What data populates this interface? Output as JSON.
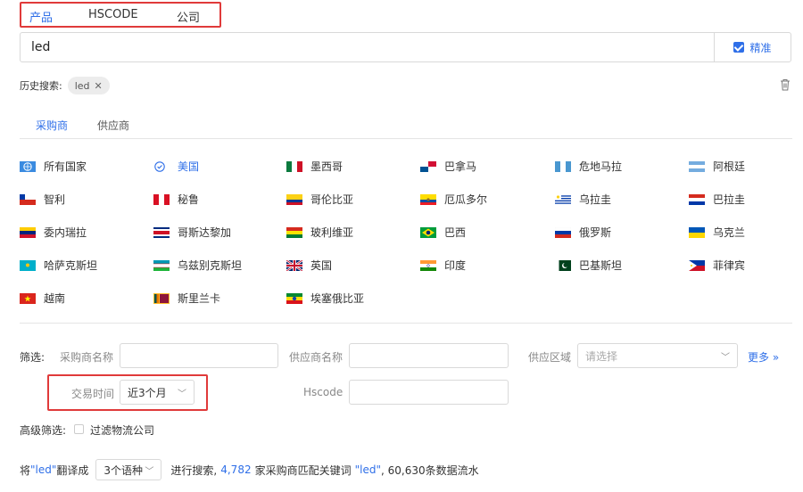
{
  "search_type_tabs": [
    {
      "label": "产品",
      "active": true
    },
    {
      "label": "HSCODE",
      "active": false
    },
    {
      "label": "公司",
      "active": false
    }
  ],
  "search": {
    "value": "led",
    "exact_label": "精准",
    "exact_checked": true
  },
  "history": {
    "label": "历史搜索:",
    "chips": [
      "led"
    ]
  },
  "role_tabs": [
    {
      "label": "采购商",
      "active": true
    },
    {
      "label": "供应商",
      "active": false
    }
  ],
  "countries": [
    {
      "name": "所有国家",
      "flag": "globe-icon"
    },
    {
      "name": "美国",
      "flag": "check-circle-icon",
      "selected": true
    },
    {
      "name": "墨西哥",
      "flag": "mexico-flag"
    },
    {
      "name": "巴拿马",
      "flag": "panama-flag"
    },
    {
      "name": "危地马拉",
      "flag": "guatemala-flag"
    },
    {
      "name": "阿根廷",
      "flag": "argentina-flag"
    },
    {
      "name": "智利",
      "flag": "chile-flag"
    },
    {
      "name": "秘鲁",
      "flag": "peru-flag"
    },
    {
      "name": "哥伦比亚",
      "flag": "colombia-flag"
    },
    {
      "name": "厄瓜多尔",
      "flag": "ecuador-flag"
    },
    {
      "name": "乌拉圭",
      "flag": "uruguay-flag"
    },
    {
      "name": "巴拉圭",
      "flag": "paraguay-flag"
    },
    {
      "name": "委内瑞拉",
      "flag": "venezuela-flag"
    },
    {
      "name": "哥斯达黎加",
      "flag": "costa-rica-flag"
    },
    {
      "name": "玻利维亚",
      "flag": "bolivia-flag"
    },
    {
      "name": "巴西",
      "flag": "brazil-flag"
    },
    {
      "name": "俄罗斯",
      "flag": "russia-flag"
    },
    {
      "name": "乌克兰",
      "flag": "ukraine-flag"
    },
    {
      "name": "哈萨克斯坦",
      "flag": "kazakhstan-flag"
    },
    {
      "name": "乌兹别克斯坦",
      "flag": "uzbekistan-flag"
    },
    {
      "name": "英国",
      "flag": "uk-flag"
    },
    {
      "name": "印度",
      "flag": "india-flag"
    },
    {
      "name": "巴基斯坦",
      "flag": "pakistan-flag"
    },
    {
      "name": "菲律宾",
      "flag": "philippines-flag"
    },
    {
      "name": "越南",
      "flag": "vietnam-flag"
    },
    {
      "name": "斯里兰卡",
      "flag": "sri-lanka-flag"
    },
    {
      "name": "埃塞俄比亚",
      "flag": "ethiopia-flag"
    }
  ],
  "filters": {
    "label": "筛选:",
    "buyer_name_label": "采购商名称",
    "supplier_name_label": "供应商名称",
    "supply_region_label": "供应区域",
    "supply_region_placeholder": "请选择",
    "more_label": "更多",
    "trade_time_label": "交易时间",
    "trade_time_value": "近3个月",
    "hscode_label": "Hscode"
  },
  "advanced": {
    "label": "高级筛选:",
    "filter_logistics_label": "过滤物流公司",
    "filter_logistics_checked": false
  },
  "translate": {
    "prefix": "将",
    "keyword_quoted": "\"led\"",
    "mid": "翻译成",
    "lang_select": "3个语种",
    "search_text": "进行搜索,",
    "buyer_count": "4,782",
    "match_text": "家采购商匹配关键词",
    "keyword_quoted2": "\"led\"",
    "flow_text": ", 60,630条数据流水"
  },
  "colors": {
    "accent": "#2f6fe8",
    "highlight_border": "#e03a3a"
  }
}
